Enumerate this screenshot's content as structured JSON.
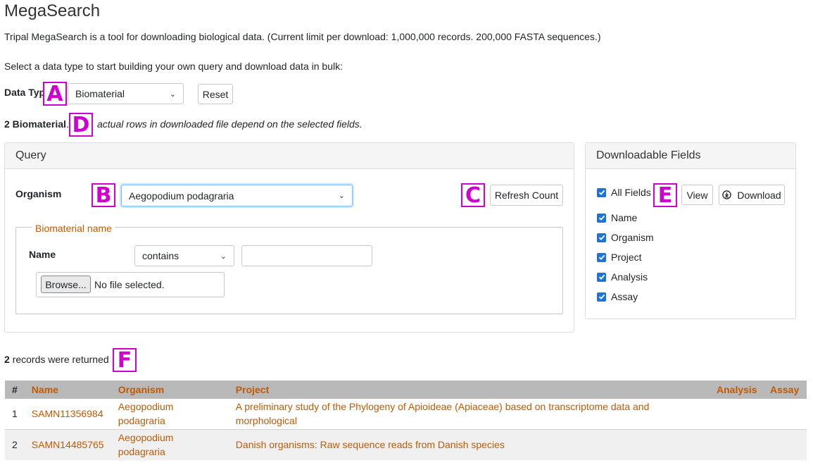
{
  "page": {
    "title": "MegaSearch",
    "description": "Tripal MegaSearch is a tool for downloading biological data. (Current limit per download: 1,000,000 records. 200,000 FASTA sequences.)",
    "select_prompt": "Select a data type to start building your own query and download data in bulk:"
  },
  "data_type": {
    "label": "Data Type:",
    "selected": "Biomaterial",
    "reset_label": "Reset"
  },
  "count": {
    "count_bold": "2 Biomaterial",
    "note": "actual rows in downloaded file depend on the selected fields."
  },
  "query": {
    "title": "Query",
    "organism_label": "Organism",
    "organism_value": "Aegopodium podagraria",
    "refresh_label": "Refresh Count",
    "fieldset_legend": "Biomaterial name",
    "name_label": "Name",
    "operator_value": "contains",
    "name_value": "",
    "browse_label": "Browse...",
    "file_status": "No file selected."
  },
  "fields_panel": {
    "title": "Downloadable Fields",
    "all_fields_label": "All Fields",
    "view_label": "View",
    "download_label": "Download",
    "fields": [
      "Name",
      "Organism",
      "Project",
      "Analysis",
      "Assay"
    ]
  },
  "results": {
    "records_count": "2",
    "records_text": "records were returned",
    "columns": [
      "#",
      "Name",
      "Organism",
      "Project",
      "Analysis",
      "Assay"
    ],
    "rows": [
      {
        "num": "1",
        "name": "SAMN11356984",
        "organism": "Aegopodium podagraria",
        "project": "A preliminary study of the Phylogeny of Apioideae (Apiaceae) based on transcriptome data and morphological",
        "analysis": "",
        "assay": ""
      },
      {
        "num": "2",
        "name": "SAMN14485765",
        "organism": "Aegopodium podagraria",
        "project": "Danish organisms: Raw sequence reads from Danish species",
        "analysis": "",
        "assay": ""
      }
    ]
  },
  "markers": [
    "A",
    "B",
    "C",
    "D",
    "E",
    "F"
  ],
  "colors": {
    "link": "#c25a00",
    "marker": "#d000d0",
    "checkbox": "#1e73d6"
  }
}
